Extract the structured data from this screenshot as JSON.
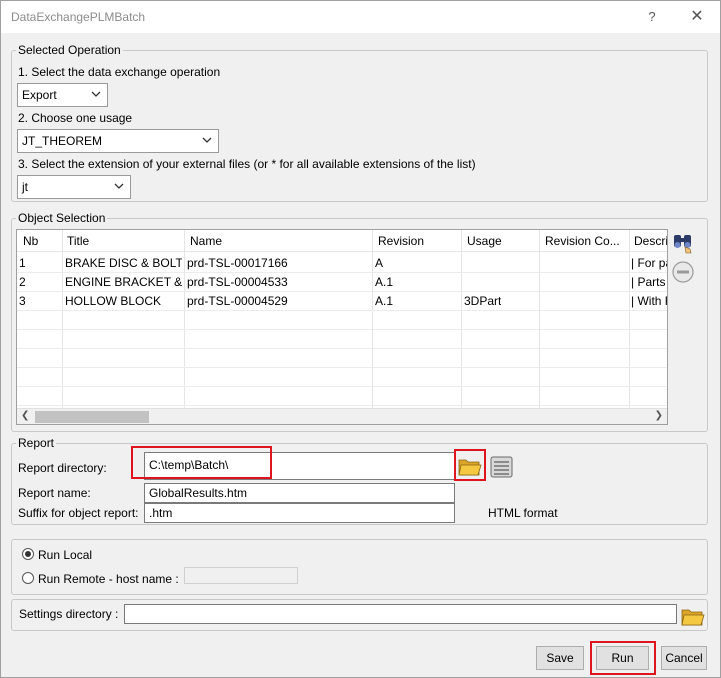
{
  "window": {
    "title": "DataExchangePLMBatch",
    "help_label": "?",
    "close_label": "✕"
  },
  "selected_operation": {
    "legend": "Selected Operation",
    "step1_label": "1. Select the data exchange operation",
    "operation_value": "Export",
    "step2_label": "2. Choose one usage",
    "usage_value": "JT_THEOREM",
    "step3_label": "3. Select the extension of your external files (or * for all available extensions of the list)",
    "extension_value": "jt"
  },
  "object_selection": {
    "legend": "Object Selection",
    "columns": [
      "Nb",
      "Title",
      "Name",
      "Revision",
      "Usage",
      "Revision Co...",
      "Descri"
    ],
    "rows": [
      [
        "1",
        "BRAKE DISC & BOLTS",
        "prd-TSL-00017166",
        "A",
        "",
        "",
        "| For pa"
      ],
      [
        "2",
        "ENGINE BRACKET & ...",
        "prd-TSL-00004533",
        "A.1",
        "",
        "",
        "| Parts v"
      ],
      [
        "3",
        "HOLLOW BLOCK",
        "prd-TSL-00004529",
        "A.1",
        "3DPart",
        "",
        "| With F"
      ]
    ],
    "search_icon": "binoculars-icon",
    "remove_icon": "remove-icon"
  },
  "report": {
    "legend": "Report",
    "directory_label": "Report directory:",
    "directory_value": "C:\\temp\\Batch\\",
    "name_label": "Report name:",
    "name_value": "GlobalResults.htm",
    "suffix_label": "Suffix for object report:",
    "suffix_value": ".htm",
    "format_label": "HTML format"
  },
  "run_mode": {
    "local_label": "Run Local",
    "remote_label": "Run Remote - host name :",
    "host_value": ""
  },
  "settings": {
    "label": "Settings directory :",
    "value": ""
  },
  "footer": {
    "save_label": "Save",
    "run_label": "Run",
    "cancel_label": "Cancel"
  },
  "colors": {
    "highlight": "#e0141e",
    "folder": "#f5c842",
    "dialog_bg": "#f0f0f0"
  }
}
